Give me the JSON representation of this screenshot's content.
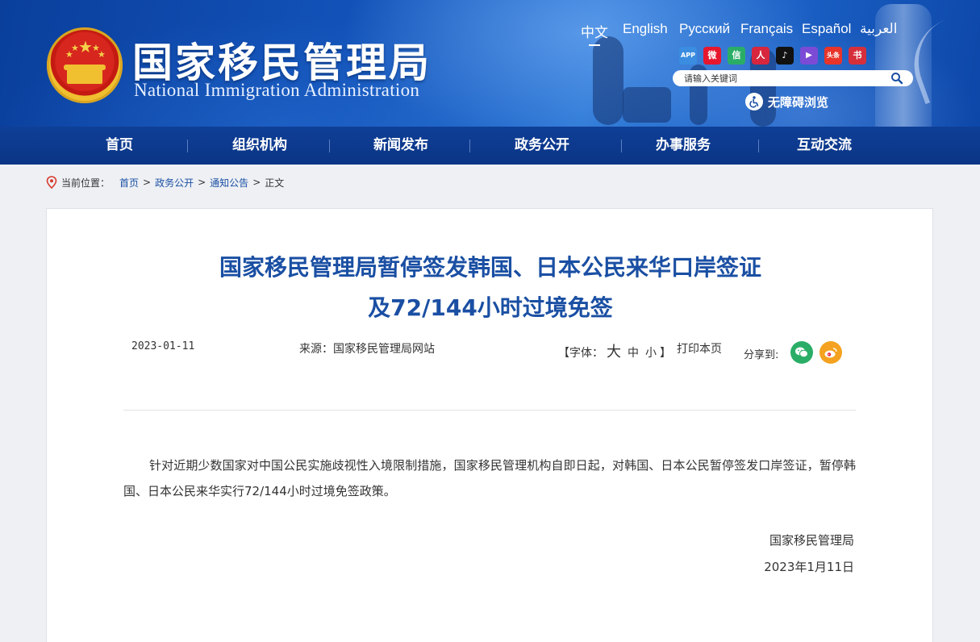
{
  "header": {
    "title": "国家移民管理局",
    "subtitle": "National Immigration Administration",
    "languages": [
      "中文",
      "English",
      "Русский",
      "Français",
      "Español",
      "العربية"
    ],
    "active_language": "中文",
    "social": [
      {
        "name": "app-icon",
        "label": "APP",
        "color": "#3a8de0"
      },
      {
        "name": "weibo-icon",
        "label": "微",
        "color": "#e6162d"
      },
      {
        "name": "wechat-icon",
        "label": "信",
        "color": "#2aae67"
      },
      {
        "name": "people-daily-icon",
        "label": "人",
        "color": "#d7263d"
      },
      {
        "name": "douyin-icon",
        "label": "♪",
        "color": "#111111"
      },
      {
        "name": "kuaishou-icon",
        "label": "▶",
        "color": "#7b4bd6"
      },
      {
        "name": "toutiao-icon",
        "label": "头条",
        "color": "#e8342a"
      },
      {
        "name": "xiaohongshu-icon",
        "label": "书",
        "color": "#d62f3c"
      }
    ],
    "search_placeholder": "请输入关键词",
    "accessibility_label": "无障碍浏览"
  },
  "nav": {
    "items": [
      "首页",
      "组织机构",
      "新闻发布",
      "政务公开",
      "办事服务",
      "互动交流"
    ]
  },
  "breadcrumb": {
    "prefix": "当前位置：",
    "links": [
      "首页",
      "政务公开",
      "通知公告"
    ],
    "current": "正文",
    "separator": ">"
  },
  "article": {
    "title_line1": "国家移民管理局暂停签发韩国、日本公民来华口岸签证",
    "title_line2": "及72/144小时过境免签",
    "date": "2023-01-11",
    "source": "来源：国家移民管理局网站",
    "font_label_open": "【字体：",
    "font_large": "大",
    "font_medium": "中",
    "font_small": "小",
    "font_label_close": "】",
    "print_label": "打印本页",
    "share_label": "分享到:",
    "body": "针对近期少数国家对中国公民实施歧视性入境限制措施，国家移民管理机构自即日起，对韩国、日本公民暂停签发口岸签证，暂停韩国、日本公民来华实行72/144小时过境免签政策。",
    "signature_org": "国家移民管理局",
    "signature_date": "2023年1月11日"
  },
  "colors": {
    "brand_blue": "#1a4fa3",
    "nav_blue": "#0f3f97",
    "wechat_green": "#2aae67",
    "weibo_orange": "#f4a21f"
  }
}
